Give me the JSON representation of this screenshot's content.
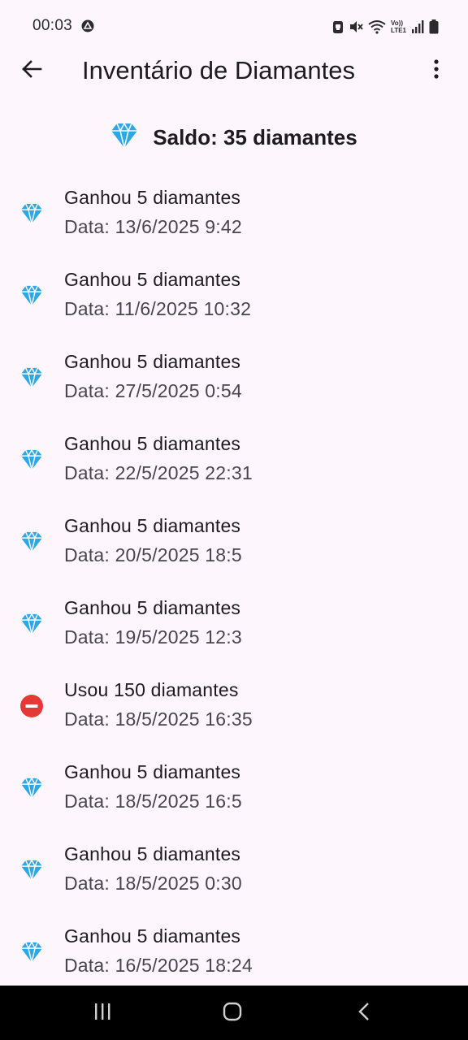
{
  "status_bar": {
    "time": "00:03",
    "icons": [
      "sync-icon",
      "lock-icon",
      "mute-icon",
      "wifi-icon",
      "volte-icon",
      "signal-icon",
      "battery-icon"
    ],
    "volte_label_top": "Vo))",
    "volte_label_bottom": "LTE1"
  },
  "app_bar": {
    "title": "Inventário de Diamantes",
    "back_icon": "arrow-left-icon",
    "menu_icon": "more-vert-icon"
  },
  "balance": {
    "icon": "diamond-icon",
    "text": "Saldo: 35 diamantes"
  },
  "colors": {
    "background": "#fdf7fd",
    "diamond": "#2aa8e8",
    "remove": "#e53935",
    "nav_bar": "#000000"
  },
  "transactions": [
    {
      "type": "gain",
      "icon": "diamond-icon",
      "title": "Ganhou 5 diamantes",
      "date": "Data: 13/6/2025 9:42"
    },
    {
      "type": "gain",
      "icon": "diamond-icon",
      "title": "Ganhou 5 diamantes",
      "date": "Data: 11/6/2025 10:32"
    },
    {
      "type": "gain",
      "icon": "diamond-icon",
      "title": "Ganhou 5 diamantes",
      "date": "Data: 27/5/2025 0:54"
    },
    {
      "type": "gain",
      "icon": "diamond-icon",
      "title": "Ganhou 5 diamantes",
      "date": "Data: 22/5/2025 22:31"
    },
    {
      "type": "gain",
      "icon": "diamond-icon",
      "title": "Ganhou 5 diamantes",
      "date": "Data: 20/5/2025 18:5"
    },
    {
      "type": "gain",
      "icon": "diamond-icon",
      "title": "Ganhou 5 diamantes",
      "date": "Data: 19/5/2025 12:3"
    },
    {
      "type": "use",
      "icon": "remove-circle-icon",
      "title": "Usou 150 diamantes",
      "date": "Data: 18/5/2025 16:35"
    },
    {
      "type": "gain",
      "icon": "diamond-icon",
      "title": "Ganhou 5 diamantes",
      "date": "Data: 18/5/2025 16:5"
    },
    {
      "type": "gain",
      "icon": "diamond-icon",
      "title": "Ganhou 5 diamantes",
      "date": "Data: 18/5/2025 0:30"
    },
    {
      "type": "gain",
      "icon": "diamond-icon",
      "title": "Ganhou 5 diamantes",
      "date": "Data: 16/5/2025 18:24"
    }
  ],
  "nav_bar": {
    "buttons": [
      "recents-icon",
      "home-icon",
      "back-icon"
    ]
  }
}
